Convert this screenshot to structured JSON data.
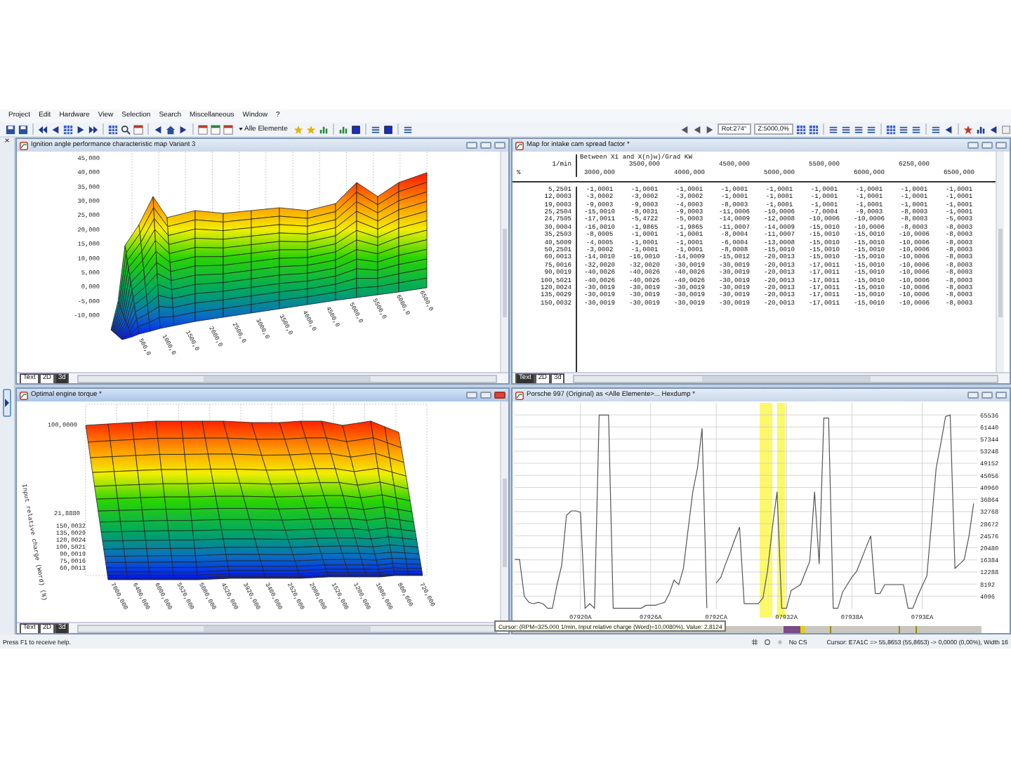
{
  "menu": [
    "Project",
    "Edit",
    "Hardware",
    "View",
    "Selection",
    "Search",
    "Miscellaneous",
    "Window",
    "?"
  ],
  "toolbar": {
    "filter": "Alle Elemente",
    "rotation": "Rot:274°",
    "zoom": "Z:5000,0%"
  },
  "side_panel": {
    "close": "×"
  },
  "windows": [
    {
      "kind": "surface",
      "title": "Ignition angle performance characteristic map Variant 3",
      "active": false,
      "yticks": [
        "45,000",
        "40,000",
        "35,000",
        "30,000",
        "25,000",
        "20,000",
        "15,000",
        "10,000",
        "5,000",
        "0,000",
        "-5,000",
        "-10,000"
      ],
      "xticks": [
        "500,0",
        "1000,0",
        "1500,0",
        "2000,0",
        "2500,0",
        "3000,0",
        "3500,0",
        "4000,0",
        "4500,0",
        "5000,0",
        "5500,0",
        "6000,0",
        "6500,0"
      ],
      "view_tabs": [
        {
          "label": "Text",
          "selected": false
        },
        {
          "label": "2D",
          "selected": false
        },
        {
          "label": "3d",
          "selected": true
        }
      ]
    },
    {
      "kind": "table",
      "title": "Map for intake cam spread factor *",
      "active": false,
      "table": {
        "note": "Between X1 and X(n)w)/Grad KW",
        "unit": "1/min",
        "corner": "%",
        "columns": [
          "3000,000",
          "3500,000",
          "4000,000",
          "4500,000",
          "5000,000",
          "5500,000",
          "6000,000",
          "6250,000",
          "6500,000"
        ],
        "rows": [
          {
            "label": "5,2501",
            "cells": [
              "-1,0001",
              "-1,0001",
              "-1,0001",
              "-1,0001",
              "-1,0001",
              "-1,0001",
              "-1,0001",
              "-1,0001",
              "-1,0001"
            ]
          },
          {
            "label": "12,0003",
            "cells": [
              "-3,0002",
              "-3,0002",
              "-3,0002",
              "-1,0001",
              "-1,0001",
              "-1,0001",
              "-1,0001",
              "-1,0001",
              "-1,0001"
            ]
          },
          {
            "label": "19,0003",
            "cells": [
              "-9,0003",
              "-9,0003",
              "-4,0003",
              "-8,0003",
              "-1,0001",
              "-1,0001",
              "-1,0001",
              "-1,0001",
              "-1,0001"
            ]
          },
          {
            "label": "25,2504",
            "cells": [
              "-15,0010",
              "-8,0031",
              "-9,0003",
              "-11,0006",
              "-10,0006",
              "-7,0004",
              "-9,0003",
              "-8,0003",
              "-1,0001"
            ]
          },
          {
            "label": "24,7505",
            "cells": [
              "-17,0011",
              "-5,4722",
              "-5,0003",
              "-14,0009",
              "-12,0008",
              "-10,0006",
              "-10,0006",
              "-8,0003",
              "-5,0003"
            ]
          },
          {
            "label": "30,0004",
            "cells": [
              "-16,0010",
              "-1,9865",
              "-1,9865",
              "-11,0007",
              "-14,0009",
              "-15,0010",
              "-10,0006",
              "-8,0003",
              "-8,0003"
            ]
          },
          {
            "label": "35,2503",
            "cells": [
              "-8,0005",
              "-1,0001",
              "-1,0001",
              "-8,0004",
              "-11,0007",
              "-15,0010",
              "-15,0010",
              "-10,0006",
              "-8,0003"
            ]
          },
          {
            "label": "40,5009",
            "cells": [
              "-4,0005",
              "-1,0001",
              "-1,0001",
              "-6,0004",
              "-13,0008",
              "-15,0010",
              "-15,0010",
              "-10,0006",
              "-8,0003"
            ]
          },
          {
            "label": "50,2501",
            "cells": [
              "-3,0002",
              "-1,0001",
              "-1,0001",
              "-8,0008",
              "-15,0010",
              "-15,0010",
              "-15,0010",
              "-10,0006",
              "-8,0003"
            ]
          },
          {
            "label": "60,0013",
            "cells": [
              "-14,0010",
              "-16,0010",
              "-14,0009",
              "-15,0012",
              "-20,0013",
              "-15,0010",
              "-15,0010",
              "-10,0006",
              "-8,0003"
            ]
          },
          {
            "label": "75,0016",
            "cells": [
              "-32,0020",
              "-32,0020",
              "-30,0019",
              "-30,0019",
              "-20,0013",
              "-17,0011",
              "-15,0010",
              "-10,0006",
              "-8,0003"
            ]
          },
          {
            "label": "90,0019",
            "cells": [
              "-40,0026",
              "-40,0026",
              "-40,0026",
              "-30,0019",
              "-20,0013",
              "-17,0011",
              "-15,0010",
              "-10,0006",
              "-8,0003"
            ]
          },
          {
            "label": "100,5021",
            "cells": [
              "-40,0026",
              "-40,0026",
              "-40,0026",
              "-30,0019",
              "-20,0013",
              "-17,0011",
              "-15,0010",
              "-10,0006",
              "-8,0003"
            ]
          },
          {
            "label": "120,0024",
            "cells": [
              "-30,0019",
              "-30,0019",
              "-30,0019",
              "-30,0019",
              "-20,0013",
              "-17,0011",
              "-15,0010",
              "-10,0006",
              "-8,0003"
            ]
          },
          {
            "label": "135,0029",
            "cells": [
              "-30,0019",
              "-30,0019",
              "-30,0019",
              "-30,0019",
              "-20,0013",
              "-17,0011",
              "-15,0010",
              "-10,0006",
              "-8,0003"
            ]
          },
          {
            "label": "150,0032",
            "cells": [
              "-30,0019",
              "-30,0019",
              "-30,0019",
              "-30,0019",
              "-20,0013",
              "-17,0011",
              "-15,0010",
              "-10,0006",
              "-8,0003"
            ]
          }
        ]
      },
      "view_tabs": [
        {
          "label": "Text",
          "selected": true
        },
        {
          "label": "2D",
          "selected": false
        },
        {
          "label": "3d",
          "selected": false
        }
      ]
    },
    {
      "kind": "surface",
      "title": "Optimal engine torque *",
      "active": true,
      "yticks": [
        "100,0000",
        "21,8880",
        "150,0032",
        "135,0029",
        "120,0024",
        "100,5021",
        "90,0019",
        "75,0016",
        "60,0013"
      ],
      "axis_title": "Input relative charge (Word) (%)",
      "xticks": [
        "7000,000",
        "6400,000",
        "6000,000",
        "5520,000",
        "5000,000",
        "4520,000",
        "3920,000",
        "3400,000",
        "2520,000",
        "2000,000",
        "1520,000",
        "1200,000",
        "1000,000",
        "800,000",
        "720,000"
      ],
      "view_tabs": [
        {
          "label": "Text",
          "selected": false
        },
        {
          "label": "2D",
          "selected": false
        },
        {
          "label": "3d",
          "selected": true
        }
      ]
    },
    {
      "kind": "hexdump",
      "title": "Porsche 997 (Original) as <Alle Elemente>... Hexdump *",
      "active": false,
      "chart_data": {
        "type": "line",
        "categories": [
          null,
          null,
          null,
          null,
          null,
          null,
          null,
          null,
          null,
          null,
          null,
          null,
          null,
          null,
          "07920A",
          null,
          null,
          null,
          null,
          null,
          null,
          null,
          null,
          null,
          null,
          null,
          null,
          null,
          null,
          "07926A",
          null,
          null,
          null,
          null,
          null,
          null,
          null,
          null,
          null,
          null,
          null,
          null,
          null,
          "0792CA",
          null,
          null,
          null,
          null,
          null,
          null,
          null,
          null,
          null,
          null,
          null,
          null,
          null,
          null,
          "07932A",
          null,
          null,
          null,
          null,
          null,
          null,
          null,
          null,
          null,
          null,
          null,
          null,
          null,
          "07938A",
          null,
          null,
          null,
          null,
          null,
          null,
          null,
          null,
          null,
          null,
          null,
          null,
          null,
          null,
          "0793EA",
          null,
          null,
          null,
          null,
          null,
          null,
          null,
          null,
          null,
          null,
          null
        ],
        "values": [
          16500,
          16500,
          4000,
          2000,
          1500,
          2000,
          1500,
          0,
          0,
          8000,
          14500,
          31500,
          33000,
          33000,
          32500,
          0,
          1500,
          0,
          65500,
          65500,
          65500,
          0,
          0,
          0,
          0,
          0,
          0,
          0,
          1000,
          1000,
          1000,
          1500,
          2000,
          5000,
          9500,
          8000,
          13500,
          26500,
          39500,
          47500,
          61000,
          0,
          null,
          8500,
          10500,
          15000,
          19000,
          23500,
          27500,
          1500,
          1500,
          1500,
          1500,
          3500,
          13000,
          27500,
          39500,
          0,
          0,
          6000,
          7000,
          8000,
          12000,
          16000,
          39500,
          15000,
          64500,
          64500,
          0,
          0,
          5500,
          8000,
          10500,
          12500,
          16500,
          20500,
          24500,
          5000,
          5000,
          8000,
          8000,
          8000,
          8000,
          8000,
          0,
          0,
          4000,
          7500,
          11000,
          29000,
          47500,
          56000,
          65000,
          65500,
          13500,
          15000,
          16500,
          24500,
          35500
        ],
        "ylim": [
          0,
          65536
        ],
        "grid": true,
        "yticks": [
          4096,
          8192,
          12288,
          16384,
          20480,
          24576,
          28672,
          32768,
          36864,
          40960,
          45056,
          49152,
          53248,
          57344,
          61440,
          65536
        ]
      }
    }
  ],
  "tooltip": "Cursor: (RPM=325.000 1/min, Input relative charge (Word)=10,0080%), Value: 2,8124",
  "status_bar": {
    "help": "Press F1 to receive help.",
    "cs": "No CS",
    "cursor": "Cursor: E7A1C => 55,8653 (55,8653) -> 0,0000 (0,00%), Width 16"
  }
}
